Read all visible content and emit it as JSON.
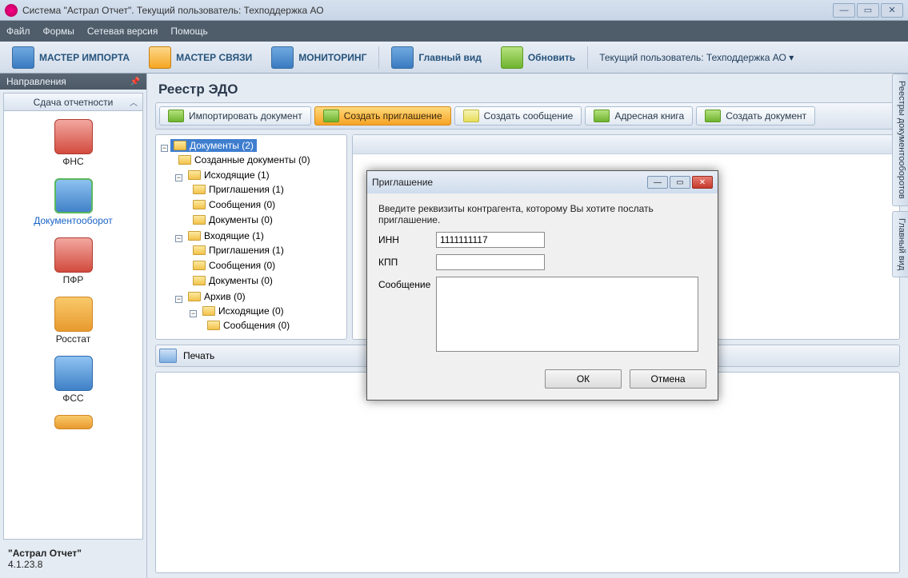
{
  "window": {
    "title": "Система \"Астрал Отчет\". Текущий пользователь: Техподдержка АО"
  },
  "menu": {
    "file": "Файл",
    "forms": "Формы",
    "network": "Сетевая версия",
    "help": "Помощь"
  },
  "toolbar": {
    "import": "МАСТЕР ИМПОРТА",
    "conn": "МАСТЕР СВЯЗИ",
    "monitor": "МОНИТОРИНГ",
    "mainview": "Главный вид",
    "refresh": "Обновить",
    "user": "Текущий пользователь: Техподдержка АО"
  },
  "sidebar": {
    "header": "Направления",
    "group": "Сдача отчетности",
    "items": [
      {
        "label": "ФНС"
      },
      {
        "label": "Документооборот"
      },
      {
        "label": "ПФР"
      },
      {
        "label": "Росстат"
      },
      {
        "label": "ФСС"
      }
    ],
    "product": "\"Астрал Отчет\"",
    "version": "4.1.23.8"
  },
  "main": {
    "title": "Реестр ЭДО",
    "actions": {
      "import": "Импортировать документ",
      "invite": "Создать приглашение",
      "message": "Создать сообщение",
      "addrbook": "Адресная книга",
      "createdoc": "Создать документ"
    },
    "print": "Печать"
  },
  "tree": {
    "root": "Документы (2)",
    "created": "Созданные документы (0)",
    "outgoing": "Исходящие (1)",
    "out_inv": "Приглашения (1)",
    "out_msg": "Сообщения (0)",
    "out_doc": "Документы (0)",
    "incoming": "Входящие (1)",
    "in_inv": "Приглашения (1)",
    "in_msg": "Сообщения (0)",
    "in_doc": "Документы (0)",
    "archive": "Архив (0)",
    "arch_out": "Исходящие (0)",
    "arch_msg": "Сообщения (0)"
  },
  "rtabs": {
    "reg": "Реестры документооборотов",
    "mv": "Главный вид"
  },
  "modal": {
    "title": "Приглашение",
    "hint": "Введите реквизиты контрагента, которому Вы хотите послать приглашение.",
    "inn_label": "ИНН",
    "inn_value": "1111111117",
    "kpp_label": "КПП",
    "kpp_value": "",
    "msg_label": "Сообщение",
    "ok": "ОК",
    "cancel": "Отмена"
  }
}
